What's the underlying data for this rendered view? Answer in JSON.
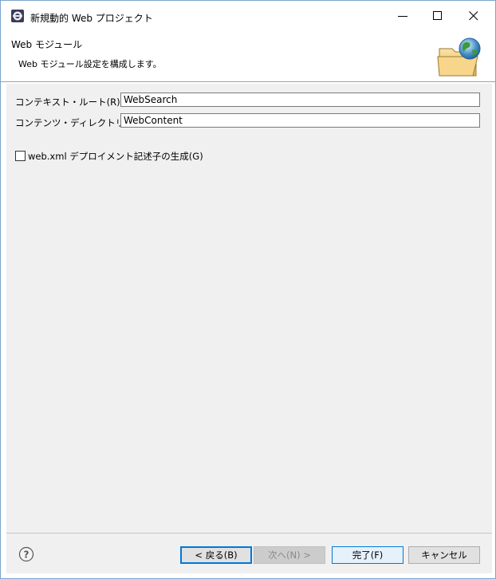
{
  "window": {
    "title": "新規動的 Web プロジェクト",
    "controls": {
      "minimize": "minimize-icon",
      "maximize": "maximize-icon",
      "close": "close-icon"
    }
  },
  "banner": {
    "title": "Web モジュール",
    "description": "Web モジュール設定を構成します。",
    "image_icon": "folder-globe-icon"
  },
  "form": {
    "context_root": {
      "label": "コンテキスト・ルート(R):",
      "value": "WebSearch"
    },
    "content_directory": {
      "label": "コンテンツ・ディレクトリー(D):",
      "value": "WebContent"
    },
    "generate_web_xml": {
      "label": "web.xml デプロイメント記述子の生成(G)",
      "checked": false
    }
  },
  "footer": {
    "help_icon": "help-icon",
    "back": "< 戻る(B)",
    "next": "次へ(N) >",
    "finish": "完了(F)",
    "cancel": "キャンセル"
  },
  "colors": {
    "accent": "#0078d7",
    "panel": "#f0f0f0",
    "window_border": "#7aa5cc"
  }
}
